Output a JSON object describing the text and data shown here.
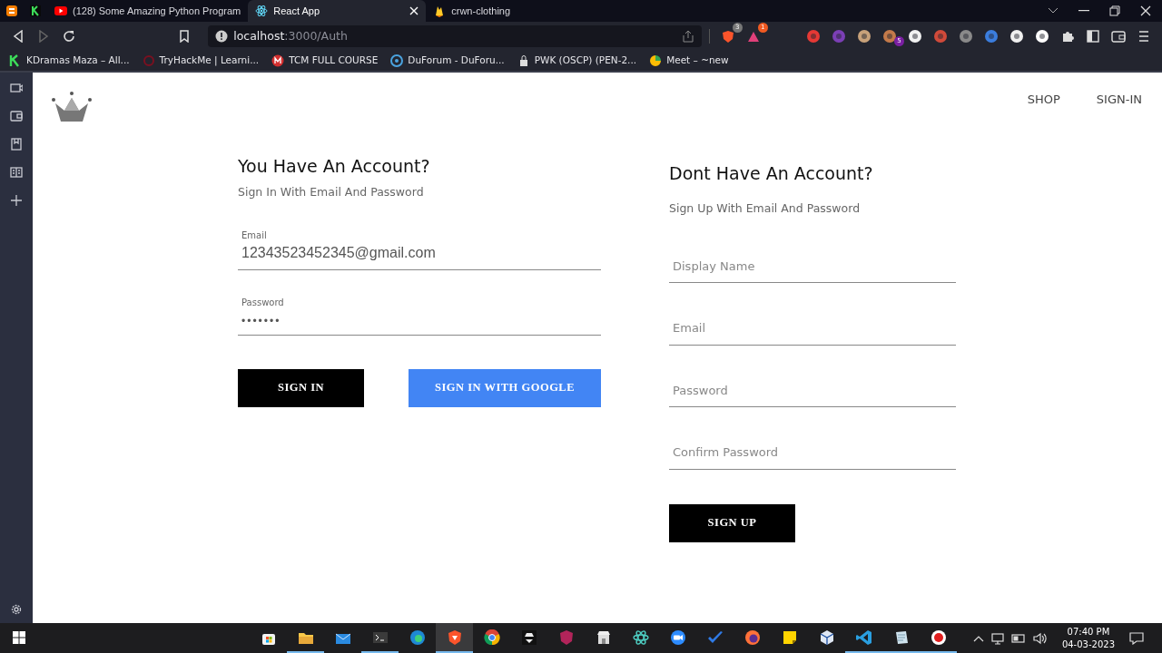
{
  "tabs": [
    {
      "kind": "pinned",
      "selected": false
    },
    {
      "kind": "pinned",
      "selected": false
    },
    {
      "kind": "page",
      "title": "(128) Some Amazing Python Program",
      "selected": false
    },
    {
      "kind": "page",
      "title": "React App",
      "selected": true
    },
    {
      "kind": "page",
      "title": "crwn-clothing",
      "selected": false
    }
  ],
  "address": {
    "host": "localhost",
    "path": ":3000/Auth"
  },
  "shield_badges": [
    "3",
    "1"
  ],
  "extension_badge": "5",
  "bookmarks": [
    "KDramas Maza – All...",
    "TryHackMe | Learni...",
    "TCM FULL COURSE",
    "DuForum - DuForu...",
    "PWK (OSCP) (PEN-2...",
    "Meet – ~new"
  ],
  "nav_links": [
    "SHOP",
    "SIGN-IN"
  ],
  "sign_in": {
    "title": "You Have An Account?",
    "subtitle": "Sign In With Email And Password",
    "fields": [
      {
        "label": "Email",
        "value": "12343523452345@gmail.com"
      },
      {
        "label": "Password",
        "value": "•••••••"
      }
    ],
    "buttons": [
      {
        "label": "SIGN IN",
        "kind": "dark"
      },
      {
        "label": "SIGN IN WITH GOOGLE",
        "kind": "google"
      }
    ]
  },
  "sign_up": {
    "title": "Dont Have An Account?",
    "subtitle": "Sign Up With Email And Password",
    "fields": [
      {
        "placeholder": "Display Name"
      },
      {
        "placeholder": "Email"
      },
      {
        "placeholder": "Password"
      },
      {
        "placeholder": "Confirm Password"
      }
    ],
    "buttons": [
      {
        "label": "SIGN UP",
        "kind": "dark"
      }
    ]
  },
  "taskbar_apps": [
    {
      "open": false,
      "selected": false
    },
    {
      "open": true,
      "selected": false
    },
    {
      "open": false,
      "selected": false
    },
    {
      "open": true,
      "selected": false
    },
    {
      "open": false,
      "selected": false
    },
    {
      "open": true,
      "selected": true
    },
    {
      "open": false,
      "selected": false
    },
    {
      "open": false,
      "selected": false
    },
    {
      "open": false,
      "selected": false
    },
    {
      "open": false,
      "selected": false
    },
    {
      "open": false,
      "selected": false
    },
    {
      "open": false,
      "selected": false
    },
    {
      "open": false,
      "selected": false
    },
    {
      "open": false,
      "selected": false
    },
    {
      "open": false,
      "selected": false
    },
    {
      "open": false,
      "selected": false
    },
    {
      "open": true,
      "selected": false
    },
    {
      "open": true,
      "selected": false
    },
    {
      "open": true,
      "selected": false
    }
  ],
  "clock": {
    "time": "07:40 PM",
    "date": "04-03-2023"
  }
}
